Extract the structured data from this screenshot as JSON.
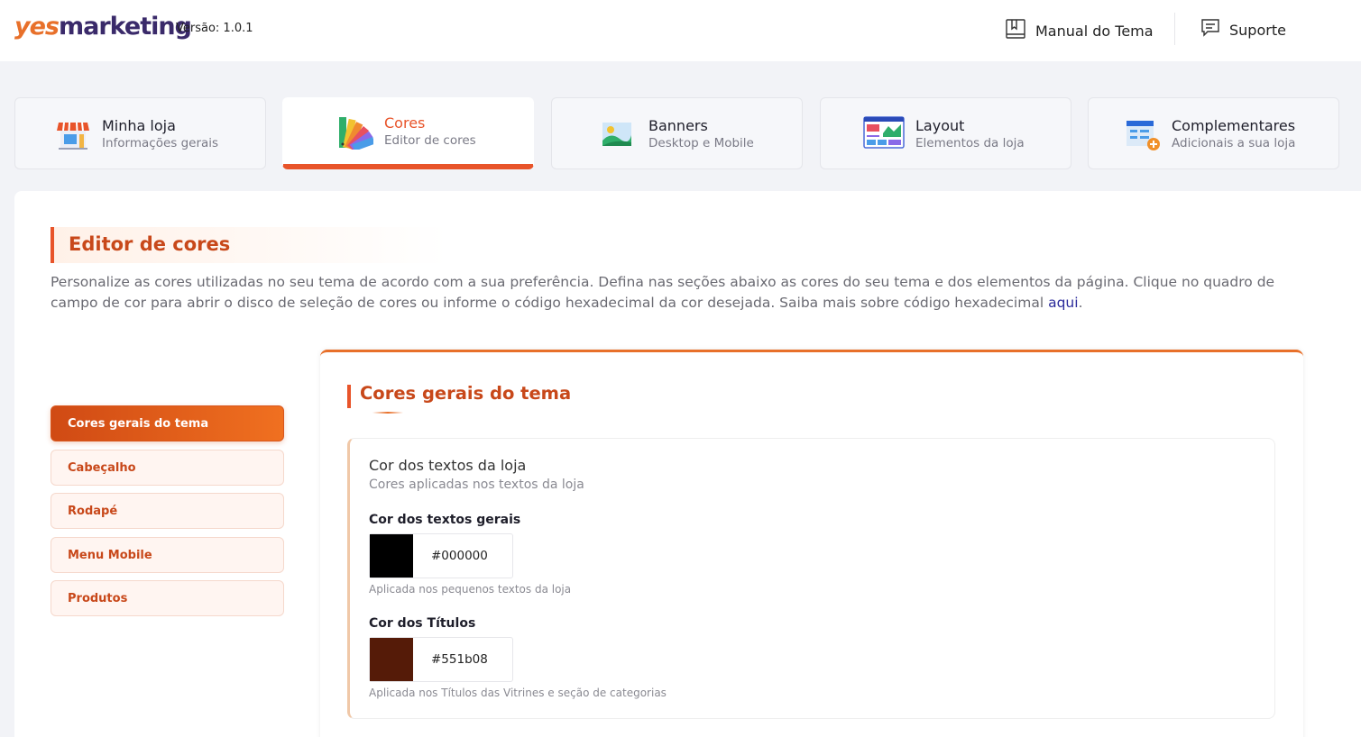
{
  "header": {
    "logo_part1": "yes",
    "logo_part2": "marketing",
    "version": "Versão: 1.0.1",
    "manual_label": "Manual do Tema",
    "support_label": "Suporte"
  },
  "tabs": [
    {
      "title": "Minha loja",
      "subtitle": "Informações gerais",
      "icon": "store-icon"
    },
    {
      "title": "Cores",
      "subtitle": "Editor de cores",
      "icon": "palette-icon",
      "active": true
    },
    {
      "title": "Banners",
      "subtitle": "Desktop e Mobile",
      "icon": "image-icon"
    },
    {
      "title": "Layout",
      "subtitle": "Elementos da loja",
      "icon": "layout-icon"
    },
    {
      "title": "Complementares",
      "subtitle": "Adicionais a sua loja",
      "icon": "addons-icon"
    }
  ],
  "page": {
    "title": "Editor de cores",
    "intro": "Personalize as cores utilizadas no seu tema de acordo com a sua preferência. Defina nas seções abaixo as cores do seu tema e dos elementos da página. Clique no quadro de campo de cor para abrir o disco de seleção de cores ou informe o código hexadecimal da cor desejada. Saiba mais sobre código hexadecimal",
    "intro_link": "aqui",
    "intro_end": "."
  },
  "sidebar": {
    "items": [
      {
        "label": "Cores gerais do tema",
        "active": true
      },
      {
        "label": "Cabeçalho"
      },
      {
        "label": "Rodapé"
      },
      {
        "label": "Menu Mobile"
      },
      {
        "label": "Produtos"
      }
    ]
  },
  "card": {
    "title": "Cores gerais do tema",
    "section": {
      "title": "Cor dos textos da loja",
      "subtitle": "Cores aplicadas nos textos da loja",
      "fields": [
        {
          "label": "Cor dos textos gerais",
          "value": "#000000",
          "help": "Aplicada nos pequenos textos da loja",
          "color": "#000000"
        },
        {
          "label": "Cor dos Títulos",
          "value": "#551b08",
          "help": "Aplicada nos Títulos das Vitrines e seção de categorias",
          "color": "#551b08"
        }
      ]
    }
  },
  "colors": {
    "accent": "#e8542a",
    "accent_dark": "#c8481a",
    "logo_orange": "#e8702a",
    "logo_purple": "#3a2a6a"
  }
}
